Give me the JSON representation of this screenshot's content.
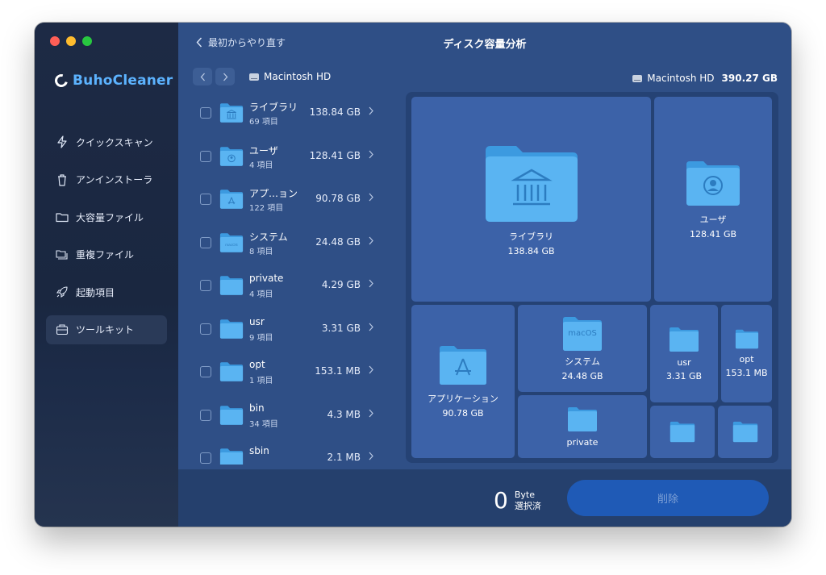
{
  "app": {
    "brand_name": "BuhoCleaner"
  },
  "sidebar": {
    "items": [
      {
        "label": "クイックスキャン",
        "icon": "bolt-icon"
      },
      {
        "label": "アンインストーラ",
        "icon": "trash-icon"
      },
      {
        "label": "大容量ファイル",
        "icon": "folder-icon"
      },
      {
        "label": "重複ファイル",
        "icon": "duplicate-folder-icon"
      },
      {
        "label": "起動項目",
        "icon": "rocket-icon"
      },
      {
        "label": "ツールキット",
        "icon": "toolkit-icon",
        "active": true
      }
    ]
  },
  "header": {
    "back_label": "最初からやり直す",
    "title": "ディスク容量分析"
  },
  "path": {
    "current": "Macintosh HD"
  },
  "disk": {
    "name": "Macintosh HD",
    "total": "390.27 GB"
  },
  "list": [
    {
      "name": "ライブラリ",
      "count": "69 項目",
      "size": "138.84 GB",
      "icon": "library-folder-icon"
    },
    {
      "name": "ユーザ",
      "count": "4 項目",
      "size": "128.41 GB",
      "icon": "users-folder-icon"
    },
    {
      "name": "アプ…ョン",
      "count": "122 項目",
      "size": "90.78 GB",
      "icon": "applications-folder-icon"
    },
    {
      "name": "システム",
      "count": "8 項目",
      "size": "24.48 GB",
      "icon": "system-folder-icon"
    },
    {
      "name": "private",
      "count": "4 項目",
      "size": "4.29 GB",
      "icon": "folder-icon"
    },
    {
      "name": "usr",
      "count": "9 項目",
      "size": "3.31 GB",
      "icon": "folder-icon"
    },
    {
      "name": "opt",
      "count": "1 項目",
      "size": "153.1 MB",
      "icon": "folder-icon"
    },
    {
      "name": "bin",
      "count": "34 項目",
      "size": "4.3 MB",
      "icon": "folder-icon"
    },
    {
      "name": "sbin",
      "count": "",
      "size": "2.1 MB",
      "icon": "folder-icon"
    }
  ],
  "treemap": {
    "library": {
      "name": "ライブラリ",
      "size": "138.84 GB"
    },
    "users": {
      "name": "ユーザ",
      "size": "128.41 GB"
    },
    "applications": {
      "name": "アプリケーション",
      "size": "90.78 GB"
    },
    "system": {
      "name": "システム",
      "size": "24.48 GB",
      "badge": "macOS"
    },
    "usr": {
      "name": "usr",
      "size": "3.31 GB"
    },
    "opt": {
      "name": "opt",
      "size": "153.1 MB"
    },
    "private": {
      "name": "private"
    }
  },
  "footer": {
    "selected_count": "0",
    "selected_unit": "Byte",
    "selected_label": "選択済",
    "delete_label": "削除"
  },
  "colors": {
    "brand_accent": "#5cb3ff",
    "folder": "#4da3e6",
    "main_bg": "#2f4f86",
    "tile": "#3c62a8",
    "delete_button": "#1f5ab6"
  }
}
